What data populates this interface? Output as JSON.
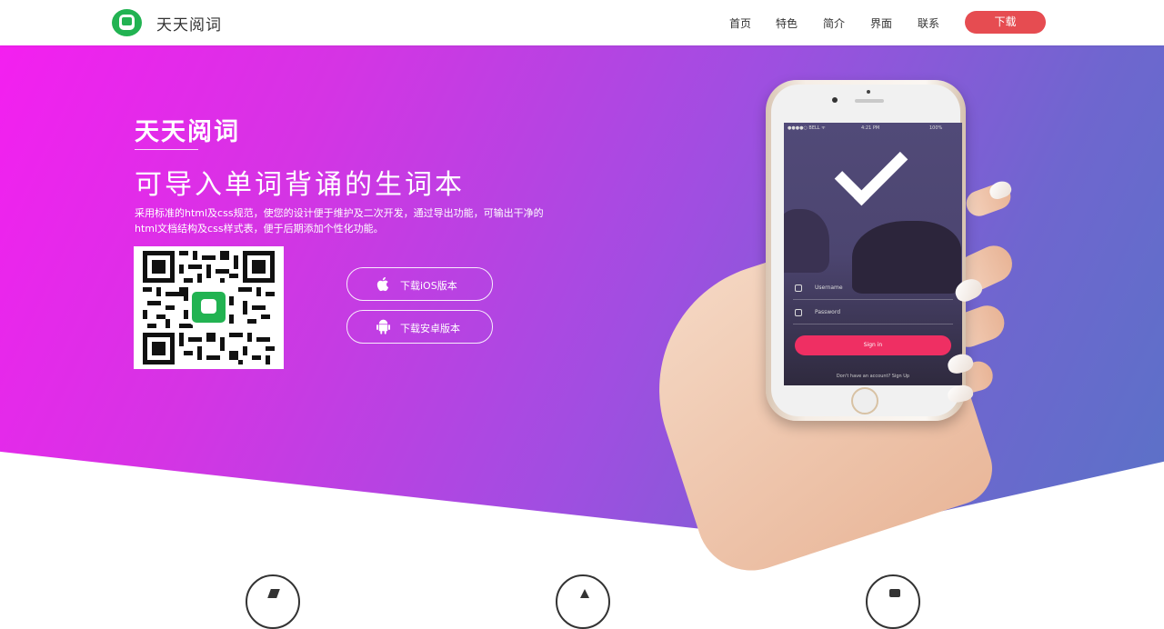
{
  "header": {
    "brand": "天天阅词",
    "nav": [
      "首页",
      "特色",
      "简介",
      "界面",
      "联系"
    ],
    "download_label": "下载"
  },
  "hero": {
    "title": "天天阅词",
    "subtitle": "可导入单词背诵的生词本",
    "description": "采用标准的html及css规范，使您的设计便于维护及二次开发，通过导出功能，可输出干净的html文档结构及css样式表，便于后期添加个性化功能。",
    "ios_button": "下载iOS版本",
    "android_button": "下载安卓版本"
  },
  "phone_screen": {
    "status_left": "●●●●○ BELL ᯤ",
    "status_time": "4:21 PM",
    "status_right": "100%",
    "username_placeholder": "Username",
    "password_placeholder": "Password",
    "signin_label": "Sign in",
    "signup_text": "Don't have an account? Sign Up"
  },
  "colors": {
    "brand_green": "#22b352",
    "download_red": "#e64c51",
    "hero_start": "#f41ff0",
    "hero_end": "#5a72c7",
    "signin_pink": "#ef2f63"
  },
  "icons": [
    "logo-icon",
    "apple-icon",
    "android-icon",
    "qr-code",
    "feature-icon-1",
    "feature-icon-2",
    "feature-icon-3"
  ]
}
